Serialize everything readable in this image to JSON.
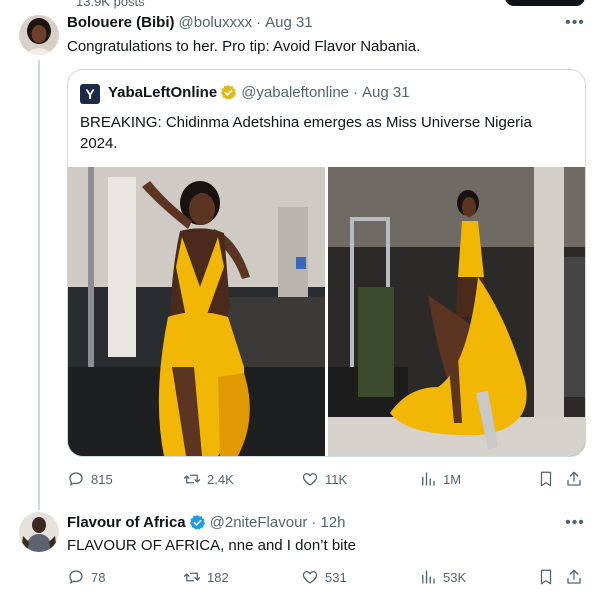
{
  "top_strip": {
    "posts_count": "13.9K posts"
  },
  "tweet1": {
    "name": "Bolouere (Bibi)",
    "handle": "@boluxxxx",
    "dot": "·",
    "time": "Aug 31",
    "text": "Congratulations to her. Pro tip: Avoid Flavor Nabania.",
    "quote": {
      "logo_letter": "Y",
      "name": "YabaLeftOnline",
      "handle": "@yabaleftonline",
      "dot": "·",
      "time": "Aug 31",
      "text": "BREAKING: Chidinma Adetshina emerges as Miss Universe Nigeria 2024."
    },
    "stats": {
      "replies": "815",
      "reposts": "2.4K",
      "likes": "11K",
      "views": "1M"
    }
  },
  "tweet2": {
    "name": "Flavour of Africa",
    "handle": "@2niteFlavour",
    "dot": "·",
    "time": "12h",
    "text": "FLAVOUR OF AFRICA, nne and I don’t bite",
    "stats": {
      "replies": "78",
      "reposts": "182",
      "likes": "531",
      "views": "53K"
    }
  },
  "colors": {
    "text": "#0f1419",
    "secondary": "#536471",
    "border": "#cfd9de",
    "verified_gold": "#e2b719",
    "verified_blue": "#1d9bf0",
    "dress_yellow": "#f2b705"
  },
  "icons": [
    "reply-icon",
    "repost-icon",
    "like-icon",
    "views-icon",
    "bookmark-icon",
    "share-icon",
    "verified-badge-icon",
    "more-icon"
  ]
}
